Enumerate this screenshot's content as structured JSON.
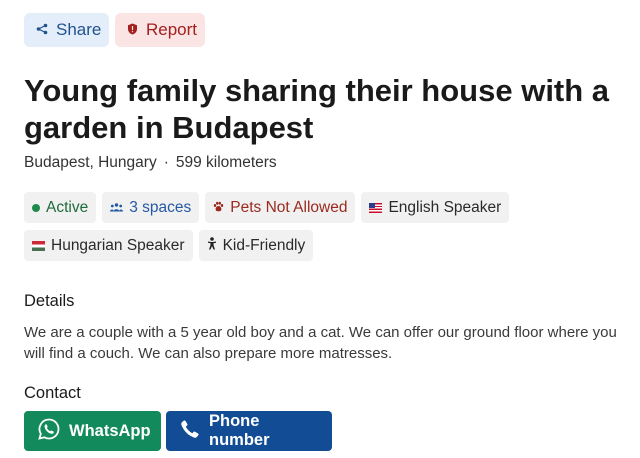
{
  "actions": {
    "share_label": "Share",
    "report_label": "Report"
  },
  "listing": {
    "title": "Young family sharing their house with a garden in Budapest",
    "location": "Budapest, Hungary",
    "separator": "·",
    "distance": "599 kilometers"
  },
  "tags": {
    "active": "Active",
    "spaces": "3 spaces",
    "pets": "Pets Not Allowed",
    "english": "English Speaker",
    "hungarian": "Hungarian Speaker",
    "kid_friendly": "Kid-Friendly"
  },
  "details": {
    "heading": "Details",
    "text": "We are a couple with a 5 year old boy and a cat. We can offer our ground floor where you will find a couch. We can also prepare more matresses."
  },
  "contact": {
    "heading": "Contact",
    "whatsapp_label": "WhatsApp",
    "phone_label": "Phone number"
  },
  "icons": {
    "share": "share-icon",
    "report": "shield-icon",
    "active": "status-dot-icon",
    "spaces": "people-icon",
    "pets": "paw-icon",
    "english": "us-flag-icon",
    "hungarian": "hungary-flag-icon",
    "kid_friendly": "child-icon",
    "whatsapp": "whatsapp-icon",
    "phone": "phone-icon"
  },
  "colors": {
    "share_bg": "#e3eefa",
    "share_fg": "#21528f",
    "report_bg": "#fbe4e4",
    "report_fg": "#a3201f",
    "active_fg": "#1f6b3c",
    "spaces_fg": "#2459a6",
    "pets_fg": "#9a2a1f",
    "whatsapp_bg": "#138a5c",
    "phone_bg": "#124c94"
  }
}
